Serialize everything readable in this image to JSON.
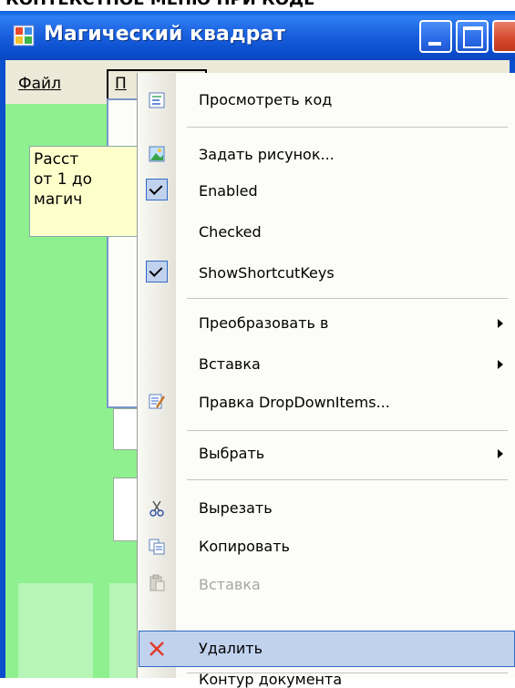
{
  "top_text": "КОНТЕКСТНОЕ МЕНЮ ПРИ КОДЕ",
  "window": {
    "title": "Магический квадрат"
  },
  "menubar": {
    "file": "Файл",
    "edit": "П"
  },
  "label": {
    "lines": [
      "Расст",
      "от 1 до",
      "магич"
    ]
  },
  "context_menu": {
    "items": [
      {
        "label": "Просмотреть код",
        "icon": "view-code-icon"
      },
      {
        "label": "Задать рисунок...",
        "icon": "image-icon"
      },
      {
        "label": "Enabled",
        "checked": true
      },
      {
        "label": "Checked",
        "checked": false
      },
      {
        "label": "ShowShortcutKeys",
        "checked": true
      },
      {
        "label": "Преобразовать в",
        "submenu": true
      },
      {
        "label": "Вставка",
        "submenu": true
      },
      {
        "label": "Правка DropDownItems...",
        "icon": "edit-items-icon"
      },
      {
        "label": "Выбрать",
        "submenu": true
      },
      {
        "label": "Вырезать",
        "icon": "scissors-icon"
      },
      {
        "label": "Копировать",
        "icon": "copy-icon"
      },
      {
        "label": "Вставка",
        "icon": "paste-icon",
        "disabled": true
      },
      {
        "label": "Удалить",
        "icon": "delete-icon",
        "highlighted": true
      },
      {
        "label": "Контур документа"
      }
    ]
  },
  "colors": {
    "form_bg": "#8ef08e",
    "titlebar": "#0b4fcf",
    "highlight": "#c1d2ee",
    "close": "#d4472a"
  }
}
